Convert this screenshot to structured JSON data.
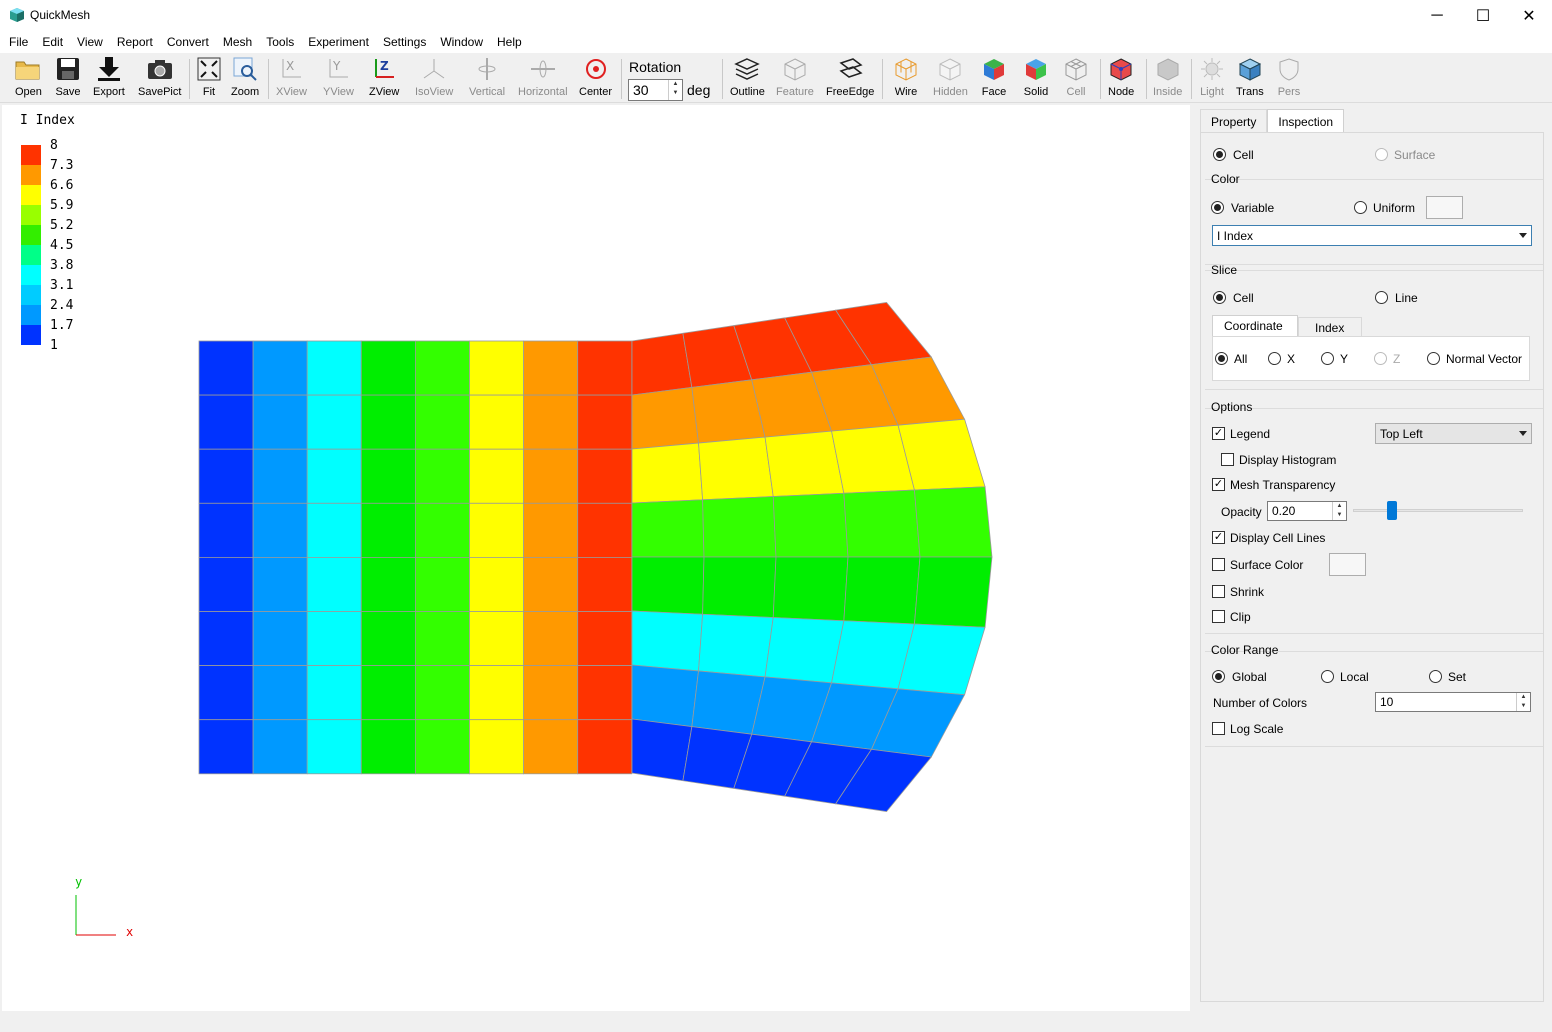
{
  "window": {
    "title": "QuickMesh",
    "minimize": "─",
    "maximize": "☐",
    "close": "✕"
  },
  "menu": [
    "File",
    "Edit",
    "View",
    "Report",
    "Convert",
    "Mesh",
    "Tools",
    "Experiment",
    "Settings",
    "Window",
    "Help"
  ],
  "toolbar": {
    "open": "Open",
    "save": "Save",
    "export": "Export",
    "savepict": "SavePict",
    "fit": "Fit",
    "zoom": "Zoom",
    "xview": "XView",
    "yview": "YView",
    "zview": "ZView",
    "isoview": "IsoView",
    "vertical": "Vertical",
    "horizontal": "Horizontal",
    "center": "Center",
    "rotation_label": "Rotation",
    "rotation_value": "30",
    "rotation_unit": "deg",
    "outline": "Outline",
    "feature": "Feature",
    "freeedge": "FreeEdge",
    "wire": "Wire",
    "hidden": "Hidden",
    "face": "Face",
    "solid": "Solid",
    "cell": "Cell",
    "node": "Node",
    "inside": "Inside",
    "light": "Light",
    "trans": "Trans",
    "pers": "Pers"
  },
  "legend": {
    "title": "I Index",
    "entries": [
      {
        "label": "8",
        "color": "#ff2b00"
      },
      {
        "label": "7.3",
        "color": "#ff8c00"
      },
      {
        "label": "6.6",
        "color": "#ffff00"
      },
      {
        "label": "5.9",
        "color": "#b4ff00"
      },
      {
        "label": "5.2",
        "color": "#3cff00"
      },
      {
        "label": "4.5",
        "color": "#00e60a"
      },
      {
        "label": "3.8",
        "color": "#00ff78"
      },
      {
        "label": "3.1",
        "color": "#00ffff"
      },
      {
        "label": "2.4",
        "color": "#0096ff"
      },
      {
        "label": "1.7",
        "color": "#0032ff"
      },
      {
        "label": "1",
        "color": ""
      }
    ]
  },
  "mesh": {
    "rect_columns": [
      1,
      2,
      3,
      4,
      5,
      6,
      7,
      8
    ],
    "rect_rows": 8,
    "fan_rows": 8,
    "fan_columns": 5,
    "fan_row_colors": [
      "#ff3300",
      "#ff9900",
      "#ffff00",
      "#33ff00",
      "#00ee00",
      "#00ffff",
      "#0099ff",
      "#0033ff"
    ],
    "column_colors": [
      "#0033ff",
      "#0099ff",
      "#00ffff",
      "#00ee00",
      "#33ff00",
      "#ffff00",
      "#ff9900",
      "#ff3300"
    ]
  },
  "axes": {
    "y": "y",
    "x": "x"
  },
  "panel": {
    "tabs": [
      "Property",
      "Inspection"
    ],
    "entity": {
      "cell": "Cell",
      "surface": "Surface"
    },
    "color": {
      "title": "Color",
      "variable": "Variable",
      "uniform": "Uniform",
      "selected_variable": "I Index"
    },
    "slice": {
      "title": "Slice",
      "cell": "Cell",
      "line": "Line",
      "tabs": [
        "Coordinate",
        "Index"
      ],
      "all": "All",
      "x": "X",
      "y": "Y",
      "z": "Z",
      "normal": "Normal Vector"
    },
    "options": {
      "title": "Options",
      "legend": "Legend",
      "legend_position": "Top Left",
      "histogram": "Display Histogram",
      "mesh_transparency": "Mesh Transparency",
      "opacity_label": "Opacity",
      "opacity_value": "0.20",
      "opacity_slider": 0.2,
      "cell_lines": "Display Cell Lines",
      "surface_color": "Surface Color",
      "shrink": "Shrink",
      "clip": "Clip"
    },
    "color_range": {
      "title": "Color Range",
      "global": "Global",
      "local": "Local",
      "set": "Set",
      "num_colors_label": "Number of Colors",
      "num_colors_value": "10",
      "log_scale": "Log Scale"
    }
  }
}
